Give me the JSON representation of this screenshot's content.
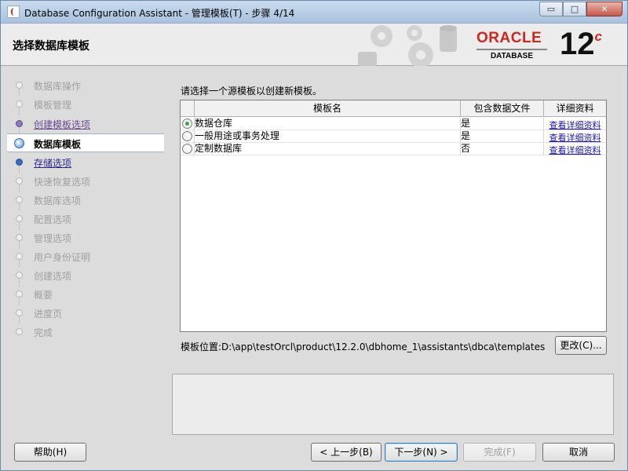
{
  "window": {
    "title": "Database Configuration Assistant - 管理模板(T) - 步骤 4/14",
    "controls": {
      "minimize": "▭",
      "maximize": "□",
      "close": "✕"
    }
  },
  "banner": {
    "title": "选择数据库模板",
    "logo_word": "ORACLE",
    "logo_sub": "DATABASE",
    "version": "12",
    "version_suffix": "c"
  },
  "steps": [
    {
      "label": "数据库操作",
      "state": "disabled"
    },
    {
      "label": "模板管理",
      "state": "disabled"
    },
    {
      "label": "创建模板选项",
      "state": "visited"
    },
    {
      "label": "数据库模板",
      "state": "current"
    },
    {
      "label": "存储选项",
      "state": "link"
    },
    {
      "label": "快速恢复选项",
      "state": "disabled"
    },
    {
      "label": "数据库选项",
      "state": "disabled"
    },
    {
      "label": "配置选项",
      "state": "disabled"
    },
    {
      "label": "管理选项",
      "state": "disabled"
    },
    {
      "label": "用户身份证明",
      "state": "disabled"
    },
    {
      "label": "创建选项",
      "state": "disabled"
    },
    {
      "label": "概要",
      "state": "disabled"
    },
    {
      "label": "进度页",
      "state": "disabled"
    },
    {
      "label": "完成",
      "state": "disabled"
    }
  ],
  "content": {
    "instruction": "请选择一个源模板以创建新模板。",
    "table": {
      "headers": [
        "模板名",
        "包含数据文件",
        "详细资料"
      ],
      "rows": [
        {
          "name": "数据仓库",
          "datafiles": "是",
          "details": "查看详细资料",
          "selected": true
        },
        {
          "name": "一般用途或事务处理",
          "datafiles": "是",
          "details": "查看详细资料",
          "selected": false
        },
        {
          "name": "定制数据库",
          "datafiles": "否",
          "details": "查看详细资料",
          "selected": false
        }
      ]
    },
    "template_location": "模板位置:D:\\app\\testOrcl\\product\\12.2.0\\dbhome_1\\assistants\\dbca\\templates",
    "change_button": "更改(C)..."
  },
  "footer": {
    "help": "帮助(H)",
    "back": "< 上一步(B)",
    "next": "下一步(N) >",
    "finish": "完成(F)",
    "cancel": "取消"
  },
  "colors": {
    "accent_red": "#d0261b",
    "link_blue": "#2c2a8c",
    "radio_selected": "#3fa33f"
  }
}
